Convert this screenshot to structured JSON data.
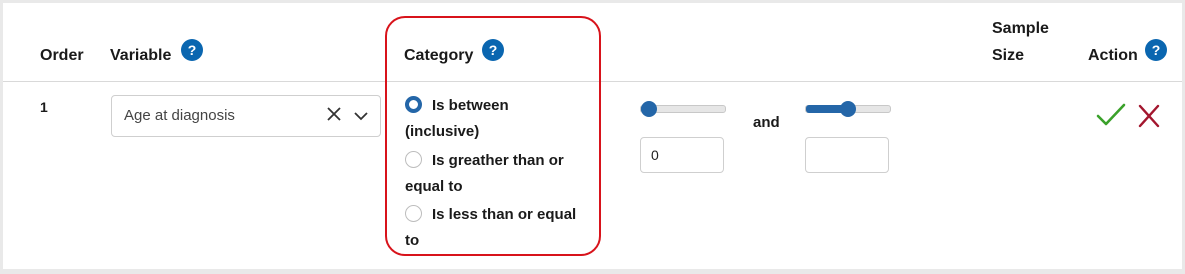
{
  "headers": {
    "order": "Order",
    "variable": "Variable",
    "category": "Category",
    "sample_size_line1": "Sample",
    "sample_size_line2": "Size",
    "action": "Action",
    "help_glyph": "?"
  },
  "row": {
    "order": "1",
    "variable_select": {
      "value": "Age at diagnosis"
    },
    "category_options": [
      {
        "line1": "Is between",
        "line2": "(inclusive)",
        "selected": true
      },
      {
        "line1": "Is greather than or",
        "line2": "equal to",
        "selected": false
      },
      {
        "line1": "Is less than or equal",
        "line2": "to",
        "selected": false
      }
    ],
    "lower_input_value": "0",
    "upper_input_value": "",
    "and_label": "and",
    "sliders": {
      "lower_level": 0.0,
      "upper_level": 0.5
    },
    "sample_size": ""
  },
  "icons": {
    "help": "help-circle-icon",
    "clear": "clear-x-icon",
    "dropdown": "chevron-down-icon",
    "confirm": "check-icon",
    "cancel": "close-x-icon"
  },
  "colors": {
    "accent_blue": "#2466a8",
    "help_blue": "#0a66b0",
    "highlight_red": "#d8131b",
    "confirm_green": "#3aa12a",
    "cancel_red": "#a3162e"
  }
}
